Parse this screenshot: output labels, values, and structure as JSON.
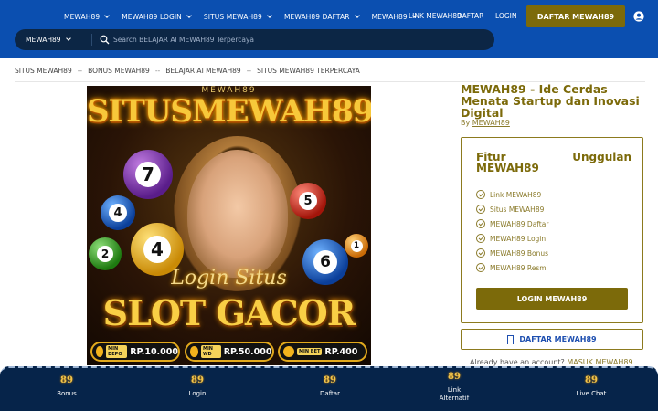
{
  "header": {
    "nav": [
      {
        "label": "MEWAH89"
      },
      {
        "label": "MEWAH89 LOGIN"
      },
      {
        "label": "SITUS MEWAH89"
      },
      {
        "label": "MEWAH89 DAFTAR"
      },
      {
        "label": "MEWAH89"
      }
    ],
    "link_label": "LINK MEWAH89",
    "daftar_link": "DAFTAR",
    "login_link": "LOGIN",
    "cta": "DAFTAR MEWAH89",
    "user_icon": "user-circle-icon",
    "brand_color": "#0b4fb0",
    "accent_color": "#7c6a0a"
  },
  "search": {
    "category": "MEWAH89",
    "placeholder": "Search BELAJAR AI MEWAH89 Terpercaya"
  },
  "breadcrumb": [
    "SITUS MEWAH89",
    "BONUS MEWAH89",
    "BELAJAR AI MEWAH89",
    "SITUS MEWAH89 TERPERCAYA"
  ],
  "hero": {
    "brand": "MEWAH89",
    "title": "SITUSMEWAH89",
    "subtitle": "Login Situs",
    "main": "SLOT GACOR",
    "balls": [
      "7",
      "4",
      "4",
      "2",
      "5",
      "6",
      "1"
    ],
    "badges": [
      {
        "label": "MIN DEPO",
        "value": "RP.10.000"
      },
      {
        "label": "MIN WD",
        "value": "RP.50.000"
      },
      {
        "label": "MIN BET",
        "value": "RP.400"
      }
    ]
  },
  "product": {
    "title": "MEWAH89 - Ide Cerdas Menata Startup dan Inovasi Digital",
    "by_prefix": "By",
    "author": "MEWAH89",
    "card": {
      "title_left": "Fitur",
      "title_right": "Unggulan",
      "title_line2": "MEWAH89",
      "features": [
        "Link MEWAH89",
        "Situs MEWAH89",
        "MEWAH89 Daftar",
        "MEWAH89 Login",
        "MEWAH89 Bonus",
        "MEWAH89 Resmi"
      ],
      "login_button": "LOGIN MEWAH89"
    },
    "daftar_button": "DAFTAR MEWAH89",
    "account_text": "Already have an account?",
    "account_link": "MASUK MEWAH89"
  },
  "bottom_nav": [
    {
      "logo": "89",
      "label": "Bonus"
    },
    {
      "logo": "89",
      "label": "Login"
    },
    {
      "logo": "89",
      "label": "Daftar"
    },
    {
      "logo": "89",
      "label": "Link Alternatif"
    },
    {
      "logo": "89",
      "label": "Live Chat"
    }
  ]
}
